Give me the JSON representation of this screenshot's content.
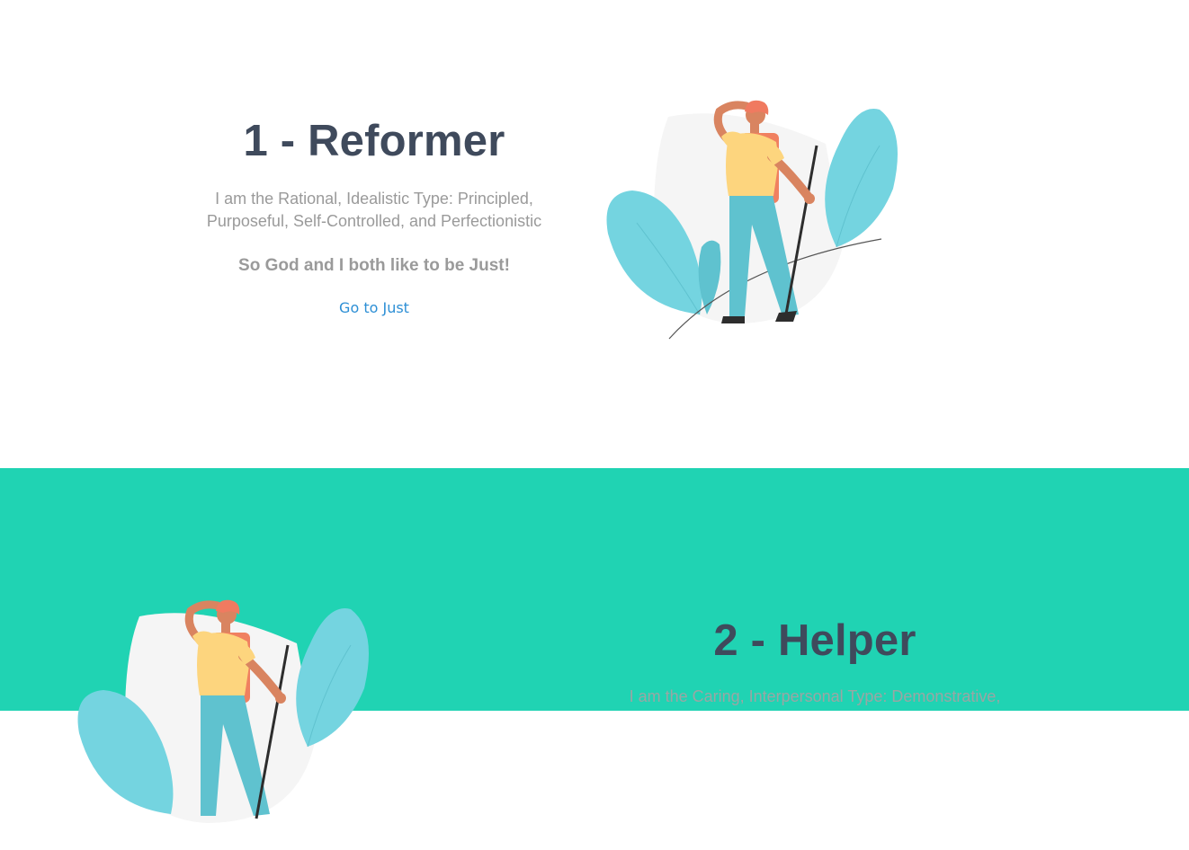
{
  "reformer": {
    "title": "1 - Reformer",
    "description_line1": "I am the Rational, Idealistic Type: Principled,",
    "description_line2": "Purposeful, Self-Controlled, and Perfectionistic",
    "tagline": "So God and I both like to be Just!",
    "link_label": "Go to Just",
    "illustration_icon": "hiker-illustration"
  },
  "helper": {
    "title": "2 - Helper",
    "description_line1": "I am the Caring, Interpersonal Type: Demonstrative,",
    "illustration_icon": "hiker-illustration",
    "background_color": "#20d3b3"
  }
}
